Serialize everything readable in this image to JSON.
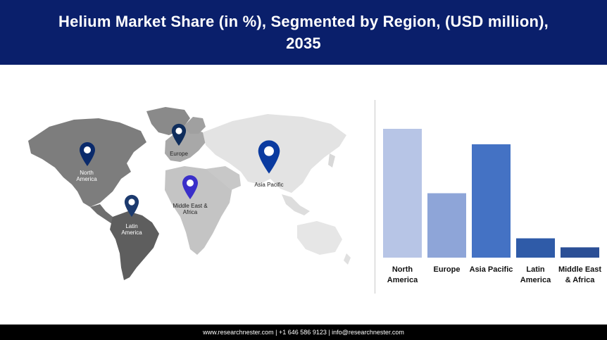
{
  "header": {
    "title": "Helium Market Share (in %), Segmented by Region, (USD million), 2035"
  },
  "map": {
    "pins": [
      {
        "label_line1": "North",
        "label_line2": "America",
        "color": "#0a2a6b"
      },
      {
        "label_line1": "Europe",
        "label_line2": "",
        "color": "#0f2d5c"
      },
      {
        "label_line1": "Asia Pacific",
        "label_line2": "",
        "color": "#0b3ba0"
      },
      {
        "label_line1": "Middle East &",
        "label_line2": "Africa",
        "color": "#3a2fc9"
      },
      {
        "label_line1": "Latin",
        "label_line2": "America",
        "color": "#1c3a6e"
      }
    ]
  },
  "chart_data": {
    "type": "bar",
    "categories": [
      "North America",
      "Europe",
      "Asia Pacific",
      "Latin America",
      "Middle East & Africa"
    ],
    "category_lines": [
      [
        "North",
        "America"
      ],
      [
        "Europe"
      ],
      [
        "Asia Pacific"
      ],
      [
        "Latin",
        "America"
      ],
      [
        "Middle East",
        "& Africa"
      ]
    ],
    "values": [
      100,
      50,
      88,
      15,
      8
    ],
    "colors": [
      "#b7c5e6",
      "#8ea5d8",
      "#4472c4",
      "#2f5ba8",
      "#2b4f96"
    ],
    "ylim": [
      0,
      100
    ],
    "xlabel": "",
    "ylabel": "",
    "grid": false
  },
  "footer": {
    "text": "www.researchnester.com | +1 646 586 9123 | info@researchnester.com"
  }
}
